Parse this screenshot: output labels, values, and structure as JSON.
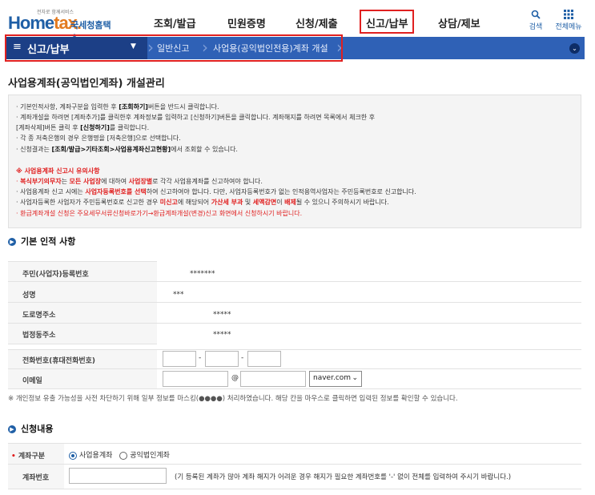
{
  "header": {
    "logo_tagline": "전자로 함께서비스",
    "logo_main": "Home",
    "logo_tax": "tax.",
    "logo_kr": "국세청홈택스",
    "menu": [
      "조회/발급",
      "민원증명",
      "신청/제출",
      "신고/납부",
      "상담/제보"
    ],
    "active_menu": "신고/납부",
    "search_label": "검색",
    "allmenu_label": "전체메뉴",
    "search_icon": "search-icon",
    "grid_icon": "grid-menu-icon"
  },
  "navbar": {
    "menu_icon": "≡",
    "current": "신고/납부",
    "breadcrumbs": [
      "일반신고",
      "사업용(공익법인전용)계좌 개설"
    ],
    "toggle": "⌄"
  },
  "page": {
    "title": "사업용계좌(공익법인계좌) 개설관리"
  },
  "notice": {
    "lines": [
      [
        "· 기본인적사항, 계좌구분을 입력한 후 ",
        "[조회하기]",
        "버튼을 반드시 클릭합니다."
      ],
      [
        "· 계좌개설을 하려면 [계좌추가]를 클릭한후 계좌정보를 입력하고 [신청하기]버튼을 클릭합니다. 계좌해지를 하려면 목록에서 체크한 후",
        "",
        ""
      ],
      [
        "  [계좌삭제]버튼 클릭 후 ",
        "[신청하기]",
        "를 클릭합니다."
      ],
      [
        "· 각 종 저축은행의 경우 은행명을 [저축은행]으로 선택합니다.",
        "",
        ""
      ],
      [
        "· 신청결과는 ",
        "[조회/발급>기타조회>사업용계좌신고현황]",
        "에서 조회할 수 있습니다."
      ]
    ],
    "warn_title": "※ 사업용계좌 신고시 유의사항",
    "warn1_a": "· ",
    "warn1_b": "복식부기의무자",
    "warn1_c": "는 ",
    "warn1_d": "모든 사업장",
    "warn1_e": "에 대하여 ",
    "warn1_f": "사업장별",
    "warn1_g": "로 각각 사업용계좌를 신고하여야 합니다.",
    "warn2_a": "· 사업용계좌 신고 시에는 ",
    "warn2_b": "사업자등록번호를 선택",
    "warn2_c": "하여 신고하여야 합니다. 다만, 사업자등록번호가 없는 인적용역사업자는 주민등록번호로 신고합니다.",
    "warn3_a": "· 사업자등록한 사업자가 주민등록번호로 신고한 경우 ",
    "warn3_b": "미신고",
    "warn3_c": "에 해당되어 ",
    "warn3_d": "가산세 부과",
    "warn3_e": " 및 ",
    "warn3_f": "세액감면",
    "warn3_g": "이 ",
    "warn3_h": "배제",
    "warn3_i": "될 수 있으니 주의하시기 바랍니다.",
    "warn4": "· 환급계좌개설 신청은 주요세무서류신청바로가기→환급계좌개설(변경)신고 화면에서 신청하시기 바랍니다."
  },
  "basic": {
    "section_title": "기본 인적 사항",
    "rows": [
      {
        "label": "주민(사업자)등록번호",
        "value": "*******"
      },
      {
        "label": "성명",
        "value": "***"
      },
      {
        "label": "도로명주소",
        "value": "*****"
      },
      {
        "label": "법정동주소",
        "value": "*****"
      }
    ],
    "phone_label": "전화번호(휴대전화번호)",
    "phone_sep": "-",
    "email_label": "이메일",
    "email_at": "@",
    "email_domain": "naver.com",
    "note": "※ 개인정보 유출 가능성을 사전 차단하기 위해 일부 정보를 마스킹(●●●●) 처리하였습니다. 해당 칸을 마우스로 클릭하면 입력된 정보를 확인할 수 있습니다."
  },
  "apply": {
    "section_title": "신청내용",
    "type_label": "계좌구분",
    "type_required": "•",
    "option1": "사업용계좌",
    "option2": "공익법인계좌",
    "selected": "사업용계좌",
    "account_label": "계좌번호",
    "account_hint": "(기 등록된 계좌가 많아 계좌 해지가 어려운 경우 해지가 필요한 계좌번호를 '-' 없이 전체를 입력하여 주시기 바랍니다.)"
  },
  "colors": {
    "brand": "#1f5fa6",
    "nav": "#2f61b6",
    "nav_dark": "#1c3f86",
    "highlight": "#e02020"
  }
}
